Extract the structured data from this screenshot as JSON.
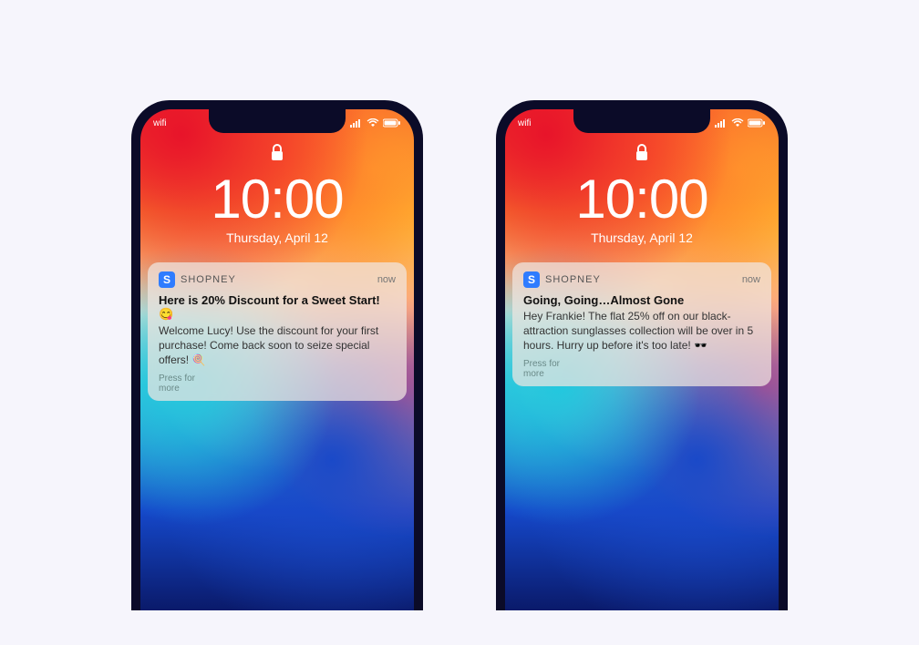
{
  "status": {
    "wifi_label": "wifi"
  },
  "lockscreen": {
    "time": "10:00",
    "date": "Thursday, April 12"
  },
  "phones": [
    {
      "notification": {
        "app_icon_letter": "S",
        "app_name": "SHOPNEY",
        "time": "now",
        "title": "Here is 20% Discount for a Sweet Start! 😋",
        "body": "Welcome Lucy! Use the discount for your first purchase! Come back soon to seize special offers! 🍭",
        "press": "Press for more"
      }
    },
    {
      "notification": {
        "app_icon_letter": "S",
        "app_name": "SHOPNEY",
        "time": "now",
        "title": "Going, Going…Almost Gone",
        "body": "Hey Frankie! The flat 25% off on our black-attraction sunglasses collection will be over in 5 hours. Hurry up before it's too late! 🕶️",
        "press": "Press for more"
      }
    }
  ]
}
